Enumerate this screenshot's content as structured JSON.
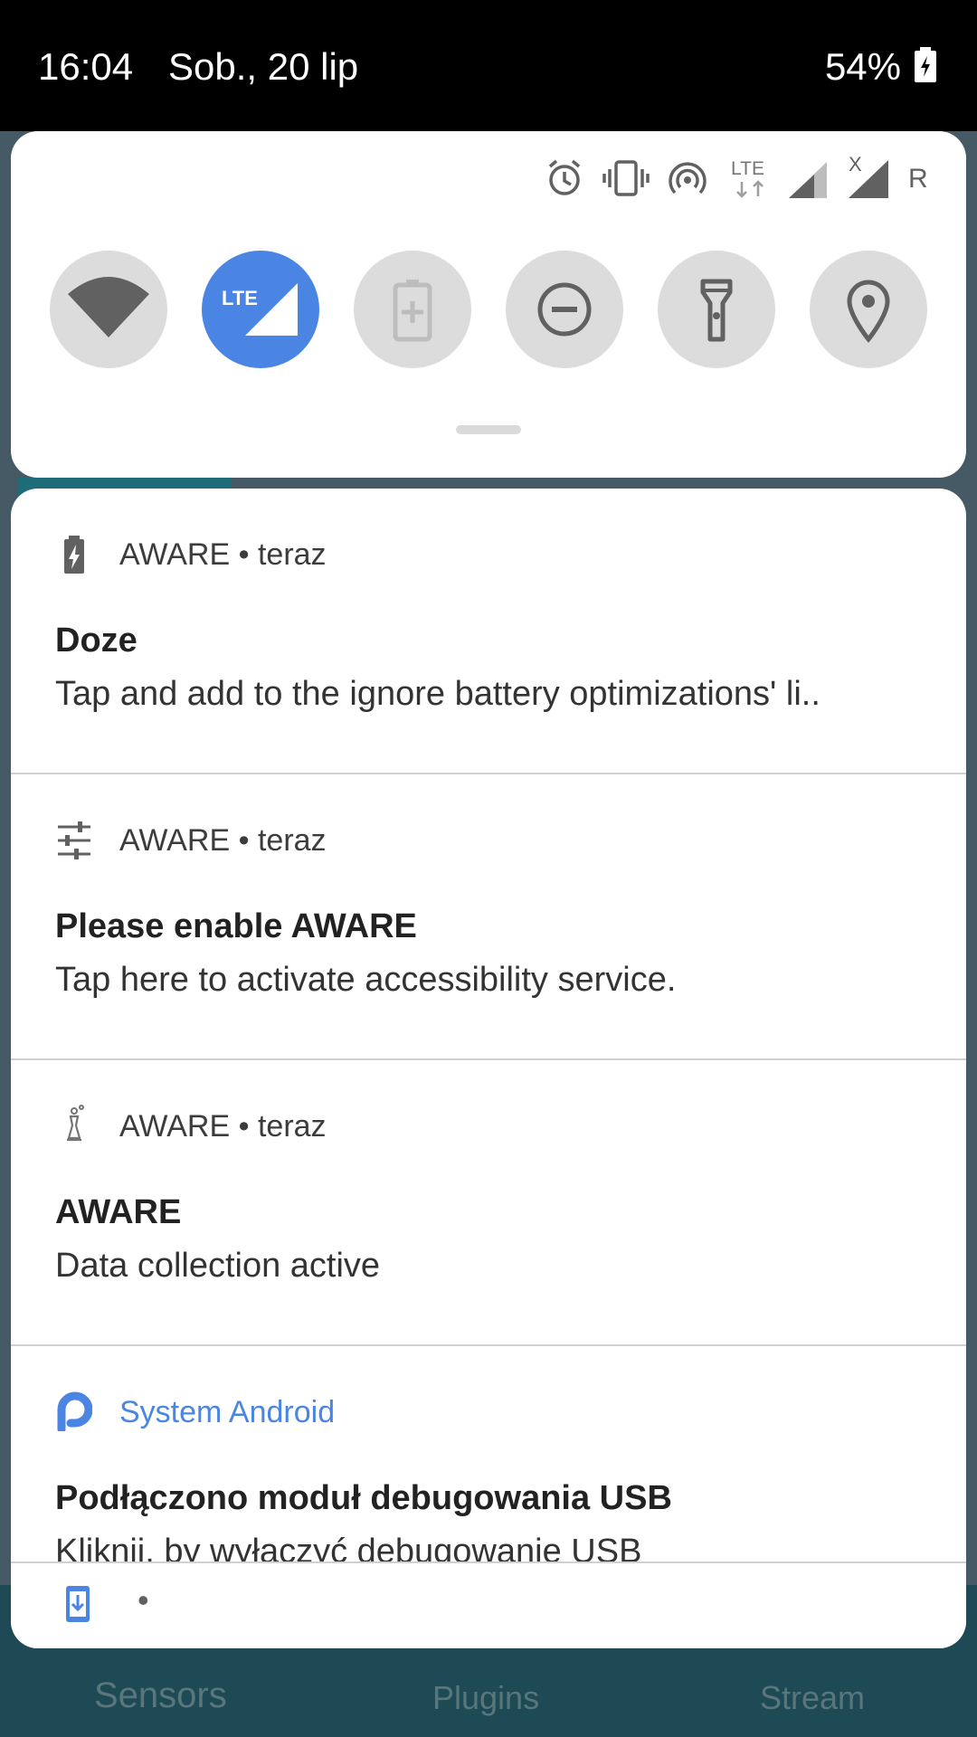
{
  "statusbar": {
    "time": "16:04",
    "date": "Sob., 20 lip",
    "battery": "54%"
  },
  "quick_settings": {
    "status_icons": [
      "alarm-icon",
      "vibrate-icon",
      "hotspot-icon",
      "lte-data-icon",
      "signal-icon",
      "signal-x-icon"
    ],
    "lte_small_label": "LTE",
    "roaming_label": "R",
    "x_label": "X",
    "tiles": [
      {
        "name": "wifi",
        "active": false
      },
      {
        "name": "mobile-data",
        "label": "LTE",
        "active": true
      },
      {
        "name": "battery-saver",
        "active": false
      },
      {
        "name": "do-not-disturb",
        "active": false
      },
      {
        "name": "flashlight",
        "active": false
      },
      {
        "name": "location",
        "active": false
      }
    ],
    "accent": "#4a85e4"
  },
  "notifications": [
    {
      "app": "AWARE",
      "separator": "•",
      "time": "teraz",
      "title": "Doze",
      "body": "Tap and add to the ignore battery optimizations' li..",
      "icon": "battery-charging-icon"
    },
    {
      "app": "AWARE",
      "separator": "•",
      "time": "teraz",
      "title": "Please enable AWARE",
      "body": "Tap here to activate accessibility service.",
      "icon": "tune-icon"
    },
    {
      "app": "AWARE",
      "separator": "•",
      "time": "teraz",
      "title": "AWARE",
      "body": "Data collection active",
      "icon": "aware-icon"
    },
    {
      "app": "System Android",
      "title": "Podłączono moduł debugowania USB",
      "body": "Kliknij, by wyłączyć debugowanie USB",
      "icon": "android-p-icon",
      "app_color": "#4a85e4"
    }
  ],
  "footer": {
    "dot": "•",
    "icon": "download-icon"
  },
  "background_tabs": [
    "Sensors",
    "Plugins",
    "Stream"
  ]
}
